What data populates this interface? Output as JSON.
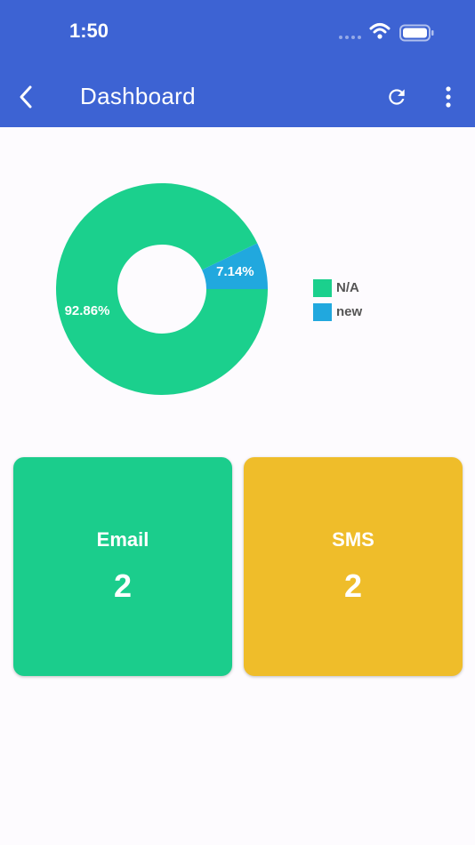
{
  "status_bar": {
    "time": "1:50"
  },
  "app_bar": {
    "title": "Dashboard",
    "background": "#3d63d3",
    "icons": [
      "back-icon",
      "refresh-icon",
      "more-vert-icon"
    ]
  },
  "chart_data": {
    "type": "pie",
    "donut": true,
    "categories": [
      "N/A",
      "new"
    ],
    "values": [
      92.86,
      7.14
    ],
    "labels": [
      "92.86%",
      "7.14%"
    ],
    "colors": [
      "#1bd08d",
      "#21a8de"
    ],
    "legend": "right"
  },
  "cards": [
    {
      "label": "Email",
      "value": "2",
      "color": "#1bcd8c"
    },
    {
      "label": "SMS",
      "value": "2",
      "color": "#efbd2a"
    }
  ]
}
